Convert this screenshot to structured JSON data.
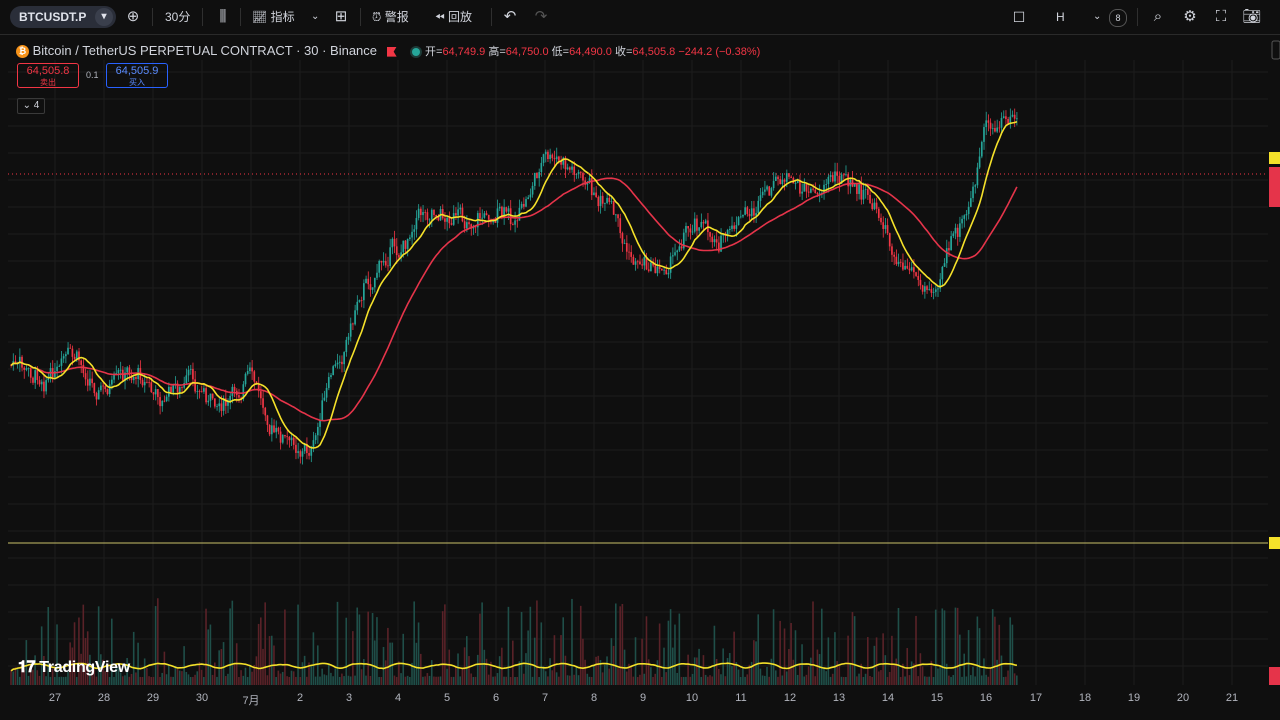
{
  "toolbar": {
    "symbol": "BTCUSDT.P",
    "interval": "30分",
    "indicators_label": "指标",
    "alert_label": "警报",
    "replay_label": "回放",
    "chart_type_label": "H",
    "badge": "8"
  },
  "legend": {
    "title": "Bitcoin / TetherUS PERPETUAL CONTRACT · 30 · Binance",
    "open_label": "开=",
    "open": "64,749.9",
    "high_label": "高=",
    "high": "64,750.0",
    "low_label": "低=",
    "low": "64,490.0",
    "close_label": "收=",
    "close": "64,505.8",
    "change": "−244.2 (−0.38%)",
    "sell_price": "64,505.8",
    "sell_label": "卖出",
    "spread": "0.1",
    "buy_price": "64,505.9",
    "buy_label": "买入",
    "collapse_count": "4"
  },
  "watermark": "TradingView",
  "colors": {
    "up": "#26a69a",
    "down": "#f23645",
    "ma_fast": "#f5e12a",
    "ma_slow": "#e5344a",
    "background": "#0f0f0f"
  },
  "chart_data": {
    "type": "candlestick",
    "x_ticks": [
      "27",
      "28",
      "29",
      "30",
      "7月",
      "2",
      "3",
      "4",
      "5",
      "6",
      "7",
      "8",
      "9",
      "10",
      "11",
      "12",
      "13",
      "14",
      "15",
      "16",
      "17",
      "18",
      "19",
      "20",
      "21"
    ],
    "price_trend": [
      0.55,
      0.52,
      0.56,
      0.5,
      0.54,
      0.48,
      0.52,
      0.46,
      0.52,
      0.4,
      0.38,
      0.56,
      0.72,
      0.78,
      0.86,
      0.84,
      0.85,
      0.84,
      0.96,
      0.94,
      0.87,
      0.76,
      0.74,
      0.84,
      0.8,
      0.86,
      0.92,
      0.9,
      0.93,
      0.88,
      0.76,
      0.7,
      0.82,
      1.02,
      1.05
    ],
    "indicators": [
      "MA fast",
      "MA slow",
      "Volume",
      "Volume MA"
    ]
  }
}
